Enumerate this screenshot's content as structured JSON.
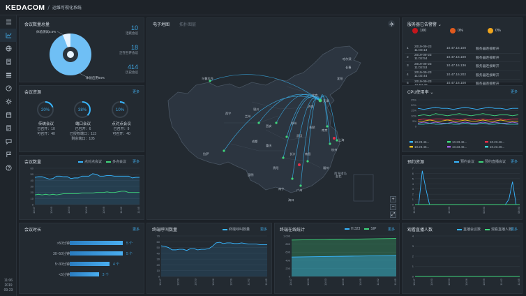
{
  "header": {
    "logo": "KEDACOM",
    "title": "运维可视化系统"
  },
  "sidebar": {
    "date_time": "11:06",
    "date_year": "2019",
    "date_md": "09-23"
  },
  "conf_overview": {
    "title": "会议数量总量",
    "pie_labels": {
      "a": "体验测试5.6%",
      "b": "体验应用94%"
    },
    "stats": [
      {
        "value": "10",
        "label": "活跃会议"
      },
      {
        "value": "18",
        "label": "正在召开会议"
      },
      {
        "value": "414",
        "label": "历史会议"
      }
    ]
  },
  "conf_resources": {
    "title": "会议资源",
    "more": "更多",
    "rings": [
      {
        "pct": "20%",
        "name": "传统会议",
        "l1": "已召开：10",
        "l2": "可召开：40",
        "frac": 0.2
      },
      {
        "pct": "38%",
        "name": "端口会议",
        "l1": "已召开：6",
        "l2": "已授权端口：113",
        "l3": "剩余端口：105",
        "frac": 0.38
      },
      {
        "pct": "10%",
        "name": "点对点会议",
        "l1": "已召开：9",
        "l2": "可召开：40",
        "frac": 0.1
      }
    ]
  },
  "conf_count": {
    "title": "会议数量",
    "more": "更多",
    "legend": [
      "点对点会议",
      "多点会议"
    ],
    "yticks": [
      "60",
      "50",
      "40",
      "30",
      "20",
      "10",
      "0"
    ],
    "xticks": [
      "10:47",
      "10:50",
      "10:53",
      "10:56",
      "10:59",
      "11:02",
      "11:05"
    ]
  },
  "conf_duration": {
    "title": "会议时长",
    "more": "更多",
    "rows": [
      {
        "label": ">50分钟",
        "value": "5 个",
        "frac": 1.0
      },
      {
        "label": "30~50分钟",
        "value": "5 个",
        "frac": 1.0
      },
      {
        "label": "5~30分钟",
        "value": "4 个",
        "frac": 0.75
      },
      {
        "label": "<5分钟",
        "value": "3 个",
        "frac": 0.55
      }
    ]
  },
  "map": {
    "tab1": "电子地图",
    "tab2": "拓扑图层",
    "zoom_in": "+",
    "zoom_out": "−",
    "fullscreen": "⤢",
    "cities": [
      "北京",
      "天津",
      "哈尔滨",
      "长春",
      "沈阳",
      "乌鲁木齐",
      "西宁",
      "兰州",
      "银川",
      "西安",
      "济南",
      "郑州",
      "合肥",
      "南京",
      "上海",
      "武汉",
      "杭州",
      "长沙",
      "南昌",
      "重庆",
      "成都",
      "贵阳",
      "昆明",
      "南宁",
      "福州",
      "广州",
      "海口",
      "拉萨",
      "台北"
    ],
    "inset_label": "南海诸岛"
  },
  "alarms": {
    "title": "服务器已告警警",
    "counts": [
      {
        "value": "100",
        "color": "#c4161c"
      },
      {
        "value": "0%",
        "color": "#e05a1e"
      },
      {
        "value": "0%",
        "color": "#f0a51c"
      }
    ],
    "rows": [
      [
        "1",
        "2019-09-23 11:03:13",
        "10.47.16.100",
        "服务器连接断开"
      ],
      [
        "2",
        "2019-09-23 11:02:54",
        "10.47.16.100",
        "服务器连接断开"
      ],
      [
        "3",
        "2019-09-23 11:02:53",
        "10.47.16.136",
        "服务器连接断开"
      ],
      [
        "4",
        "2019-09-23 11:02:44",
        "10.47.16.202",
        "服务器连接断开"
      ],
      [
        "5",
        "2019-09-23 10:53:26",
        "10.47.16.100",
        "服务器连接断开"
      ]
    ]
  },
  "cpu": {
    "title": "CPU使用率",
    "more": "更多",
    "yticks": [
      "25%",
      "20%",
      "15%",
      "10%",
      "5%",
      "0"
    ],
    "legend": [
      {
        "name": "10.23.46...",
        "color": "#38b6ff"
      },
      {
        "name": "10.23.46...",
        "color": "#3fd67c"
      },
      {
        "name": "10.23.46...",
        "color": "#e2304a"
      },
      {
        "name": "10.23.46...",
        "color": "#f0c020"
      },
      {
        "name": "10.23.46...",
        "color": "#a060e0"
      },
      {
        "name": "10.23.46...",
        "color": "#3ad0d0"
      }
    ]
  },
  "reserve": {
    "title": "预约资源",
    "more": "更多",
    "legend": [
      "预约会议",
      "预约直播会议"
    ],
    "yticks": [
      "7",
      "6",
      "5",
      "4",
      "3",
      "2",
      "1",
      "0"
    ],
    "xticks": [
      "11:00",
      "12:00",
      "00:00",
      "08:00"
    ]
  },
  "terminal_calls": {
    "title": "终端呼叫数量",
    "more": "更多",
    "legend": [
      "终端呼叫数量"
    ],
    "yticks": [
      "70",
      "60",
      "50",
      "40",
      "30",
      "20",
      "10",
      "0"
    ],
    "xticks": [
      "10:47",
      "10:50",
      "10:53",
      "10:56",
      "10:59",
      "11:02",
      "11:05"
    ]
  },
  "terminal_online": {
    "title": "终端在线统计",
    "more": "更多",
    "legend": [
      "H.323",
      "SIP"
    ],
    "yticks": [
      "1,000",
      "800",
      "600",
      "400",
      "200",
      "0"
    ],
    "xticks": [
      "10:47",
      "10:50",
      "10:53",
      "10:56",
      "10:59",
      "11:02",
      "11:05"
    ]
  },
  "live": {
    "title": "观看直播人数",
    "more": "更多",
    "legend": [
      "直播会议数",
      "观看直播人数"
    ],
    "yticks": [
      "4",
      "3",
      "2",
      "1",
      "0"
    ],
    "xticks": [
      "10:47",
      "10:50",
      "10:53",
      "10:56",
      "10:59",
      "11:02",
      "11:05"
    ]
  }
}
